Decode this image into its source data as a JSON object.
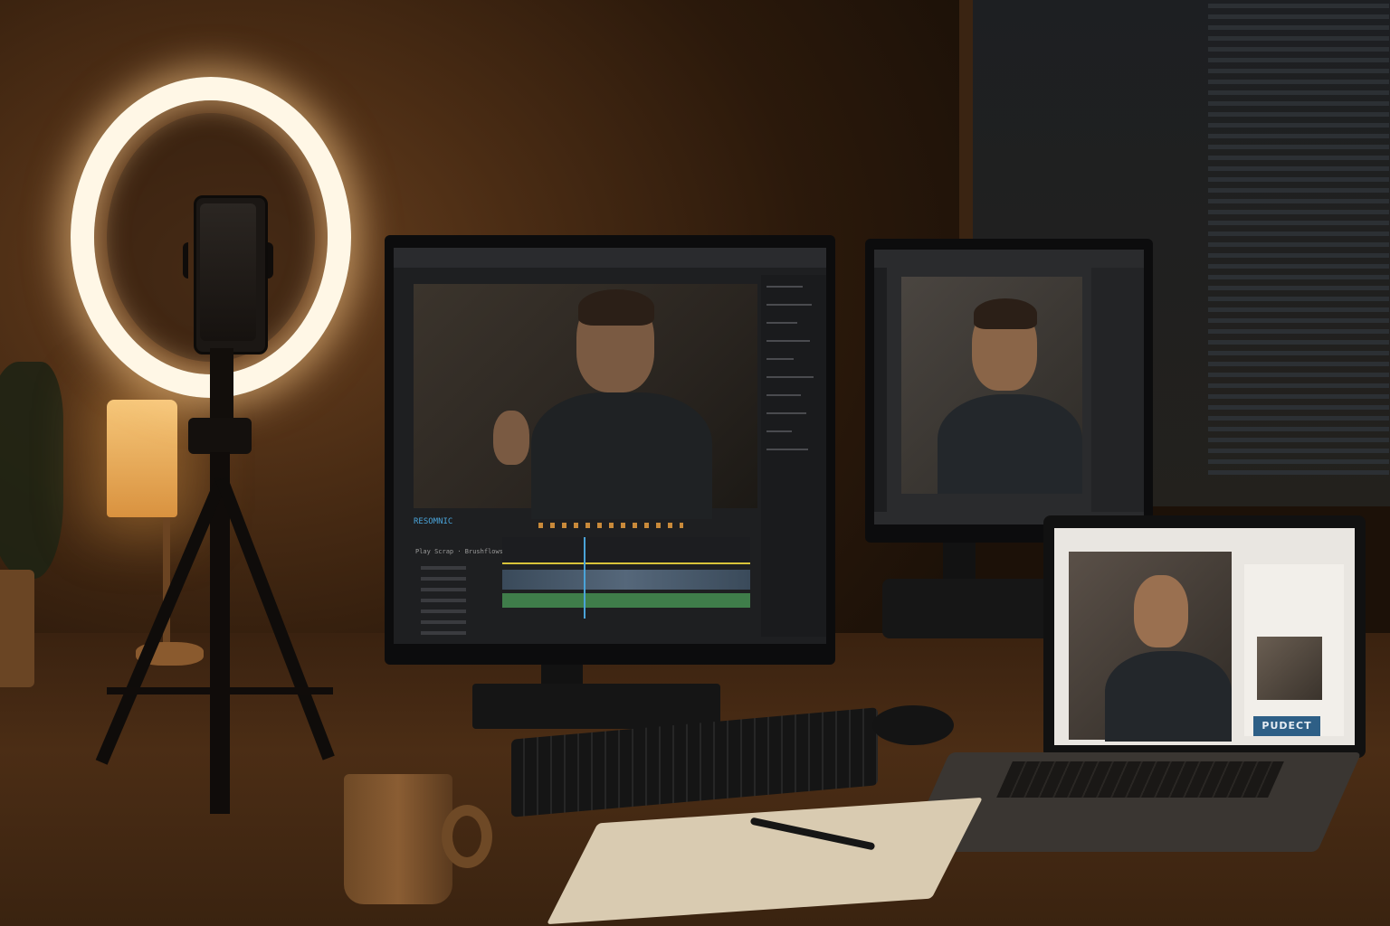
{
  "scene": {
    "description_colors": {
      "wall": "#4a2c14",
      "desk": "#4b2d15",
      "ring_light": "#fff7e6",
      "lamp": "#f6c77a",
      "accent_blue": "#2e5f86",
      "timeline_yellow": "#d8c33a",
      "timeline_green": "#3f7d4a"
    }
  },
  "main_monitor": {
    "timeline_label": "RESOMNIC",
    "track_label": "Play Scrap · Brushflows"
  },
  "laptop": {
    "action_button": "PUDECT"
  }
}
